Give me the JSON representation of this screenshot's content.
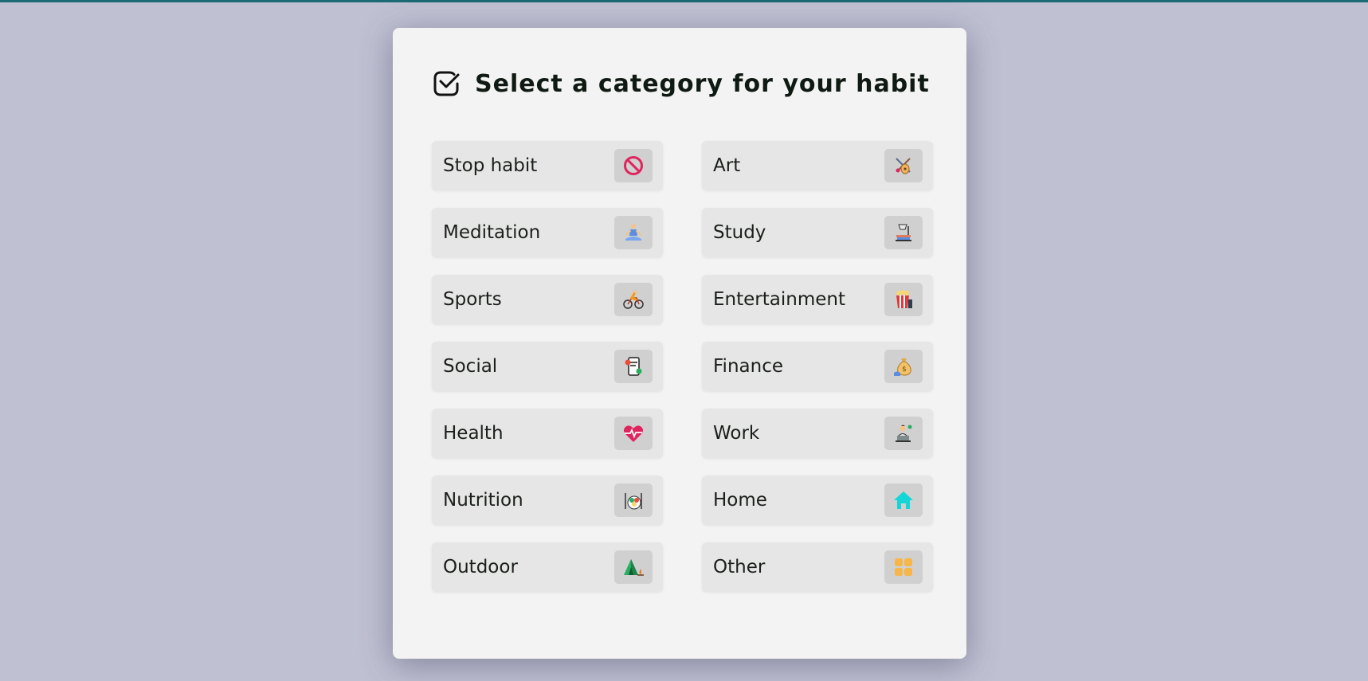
{
  "title": "Select a category for your habit",
  "categories": [
    {
      "label": "Stop habit",
      "icon": "no-entry-icon"
    },
    {
      "label": "Art",
      "icon": "art-icon"
    },
    {
      "label": "Meditation",
      "icon": "meditation-icon"
    },
    {
      "label": "Study",
      "icon": "study-icon"
    },
    {
      "label": "Sports",
      "icon": "cyclist-icon"
    },
    {
      "label": "Entertainment",
      "icon": "popcorn-icon"
    },
    {
      "label": "Social",
      "icon": "social-phone-icon"
    },
    {
      "label": "Finance",
      "icon": "money-bag-icon"
    },
    {
      "label": "Health",
      "icon": "heartbeat-icon"
    },
    {
      "label": "Work",
      "icon": "laptop-worker-icon"
    },
    {
      "label": "Nutrition",
      "icon": "salad-icon"
    },
    {
      "label": "Home",
      "icon": "house-icon"
    },
    {
      "label": "Outdoor",
      "icon": "tent-icon"
    },
    {
      "label": "Other",
      "icon": "grid-squares-icon"
    }
  ],
  "colors": {
    "background": "#c0c0d3",
    "top_bar": "#1c6a73",
    "modal": "#f3f3f3",
    "item": "#e6e6e6",
    "icon_box": "#d0d0d0"
  }
}
